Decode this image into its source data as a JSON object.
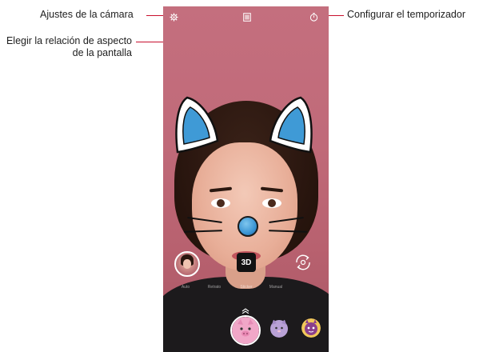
{
  "callouts": {
    "camera_settings": "Ajustes de la cámara",
    "aspect_ratio_line1": "Elegir la relación de aspecto",
    "aspect_ratio_line2": "de la pantalla",
    "timer": "Configurar el temporizador"
  },
  "camera": {
    "modes": [
      "Auto",
      "Retrato",
      "Sticker",
      "Manual"
    ],
    "effect_badge": "3D",
    "stickers": [
      {
        "name": "pig-face",
        "color": "#f1a7c8"
      },
      {
        "name": "cat-face",
        "color": "#b9a1d6"
      },
      {
        "name": "monster-face",
        "color": "#f1c75a"
      }
    ]
  },
  "colors": {
    "callout_line": "#c8102e",
    "background": "#c06a79",
    "filter_blue": "#3b95d4"
  }
}
